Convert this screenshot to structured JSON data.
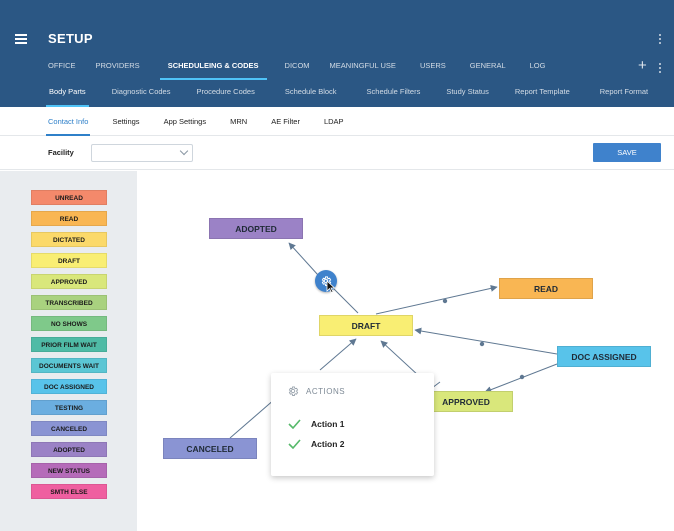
{
  "header": {
    "app_title": "SETUP",
    "menu_icon": "hamburger-icon",
    "primary_nav": [
      "OFFICE",
      "PROVIDERS",
      "SCHEDULEING & CODES",
      "DICOM",
      "MEANINGFUL USE",
      "USERS",
      "GENERAL",
      "LOG"
    ],
    "primary_active": "SCHEDULEING & CODES",
    "secondary_nav": [
      "Body Parts",
      "Diagnostic Codes",
      "Procedure Codes",
      "Schedule Block",
      "Schedule Filters",
      "Study Status",
      "Report Template",
      "Report Format"
    ],
    "secondary_active": "Body Parts",
    "add_icon": "+"
  },
  "tabs": [
    "Contact Info",
    "Settings",
    "App Settings",
    "MRN",
    "AE Filter",
    "LDAP"
  ],
  "active_tab": "Contact Info",
  "filter": {
    "facility_label": "Facility",
    "facility_value": "",
    "save_label": "SAVE"
  },
  "statuses": [
    {
      "label": "UNREAD",
      "color": "#f4896b"
    },
    {
      "label": "READ",
      "color": "#f9b653"
    },
    {
      "label": "DICTATED",
      "color": "#fbd96a"
    },
    {
      "label": "DRAFT",
      "color": "#f9ee73"
    },
    {
      "label": "APPROVED",
      "color": "#d9e77b"
    },
    {
      "label": "TRANSCRIBED",
      "color": "#a9d27f"
    },
    {
      "label": "NO SHOWS",
      "color": "#7fc98a"
    },
    {
      "label": "PRIOR FILM WAIT",
      "color": "#4fbba6"
    },
    {
      "label": "DOCUMENTS WAIT",
      "color": "#5bc6d4"
    },
    {
      "label": "DOC ASSIGNED",
      "color": "#58c3ea"
    },
    {
      "label": "TESTING",
      "color": "#6baee0"
    },
    {
      "label": "CANCELED",
      "color": "#8a94d3"
    },
    {
      "label": "ADOPTED",
      "color": "#9b82c6"
    },
    {
      "label": "NEW STATUS",
      "color": "#b56bb9"
    },
    {
      "label": "SMTH ELSE",
      "color": "#ef5fa0"
    }
  ],
  "workflow": {
    "nodes": [
      {
        "id": "adopted",
        "label": "ADOPTED",
        "color": "#9b82c6"
      },
      {
        "id": "read",
        "label": "READ",
        "color": "#f9b653"
      },
      {
        "id": "draft",
        "label": "DRAFT",
        "color": "#f9ee73"
      },
      {
        "id": "doc_assigned",
        "label": "DOC ASSIGNED",
        "color": "#58c3ea"
      },
      {
        "id": "approved",
        "label": "APPROVED",
        "color": "#d9e77b"
      },
      {
        "id": "canceled",
        "label": "CANCELED",
        "color": "#8a94d3"
      }
    ],
    "edge_color": "#5f7892",
    "gear_icon": "gear-icon"
  },
  "actions_popup": {
    "title": "ACTIONS",
    "items": [
      "Action 1",
      "Action 2"
    ],
    "check_color": "#56b96a"
  }
}
